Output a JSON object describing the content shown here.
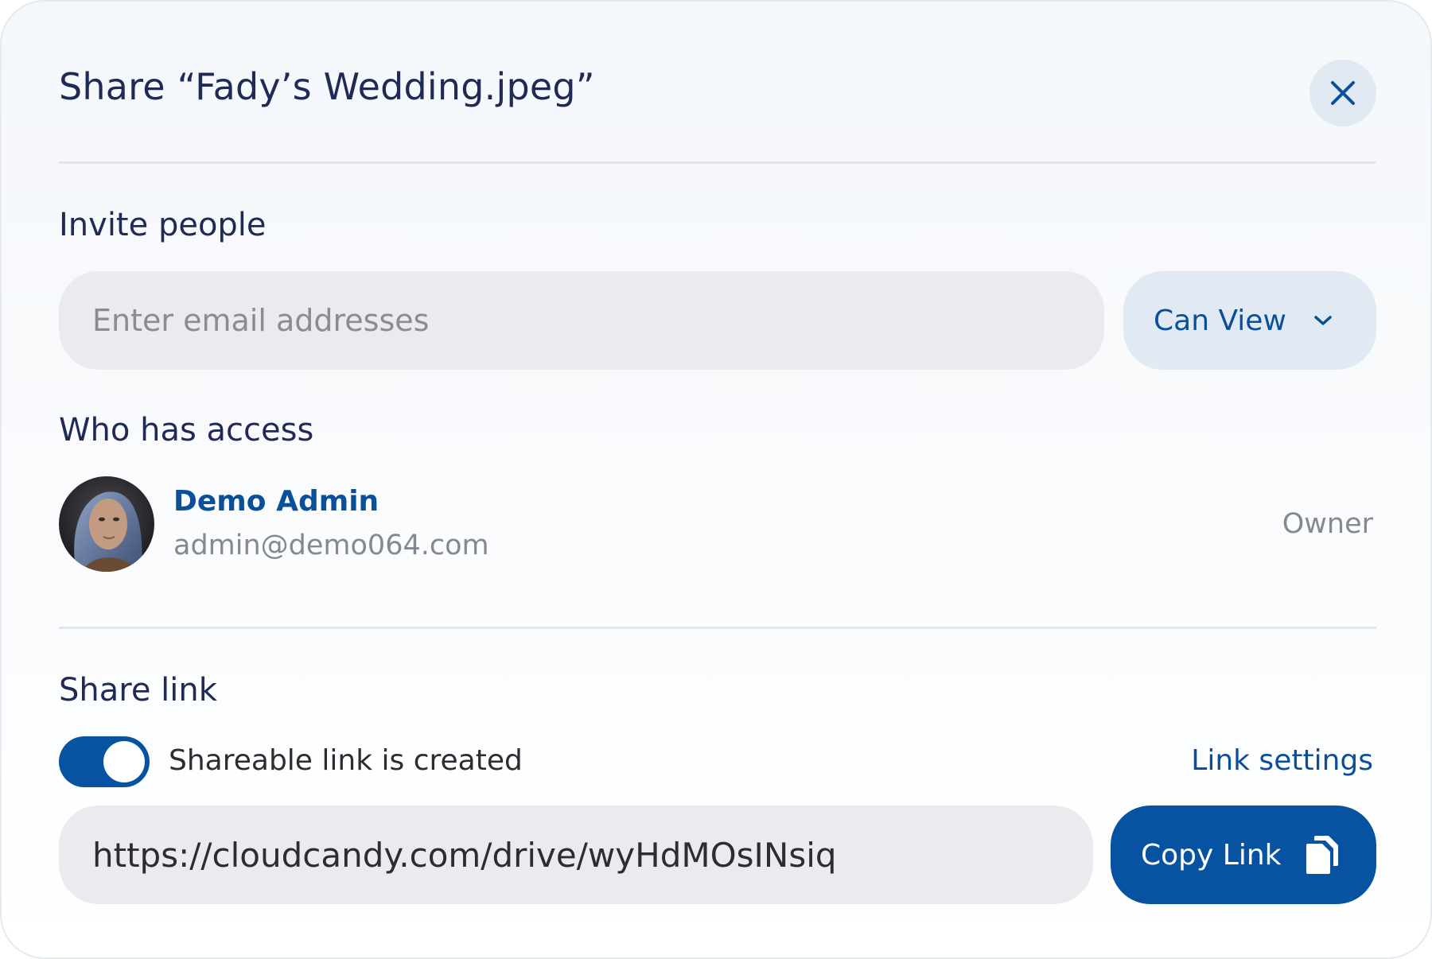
{
  "dialog": {
    "title": "Share “Fady’s Wedding.jpeg”"
  },
  "invite": {
    "heading": "Invite people",
    "email_placeholder": "Enter email addresses",
    "email_value": "",
    "permission": "Can View"
  },
  "access": {
    "heading": "Who has access",
    "users": [
      {
        "name": "Demo Admin",
        "email": "admin@demo064.com",
        "role": "Owner"
      }
    ]
  },
  "share_link": {
    "heading": "Share link",
    "toggle_on": true,
    "toggle_label": "Shareable link is created",
    "settings_label": "Link settings",
    "url": "https://cloudcandy.com/drive/wyHdMOsINsiq",
    "copy_label": "Copy Link"
  },
  "colors": {
    "primary": "#0753a2",
    "link_text": "#0a4f9a",
    "heading_text": "#1f2a55",
    "muted_text": "#858891",
    "field_bg": "#e9ebef",
    "soft_blue_bg": "#e1e9f3"
  },
  "icons": {
    "close": "close-icon",
    "dropdown": "chevron-down-icon",
    "copy": "copy-icon"
  }
}
